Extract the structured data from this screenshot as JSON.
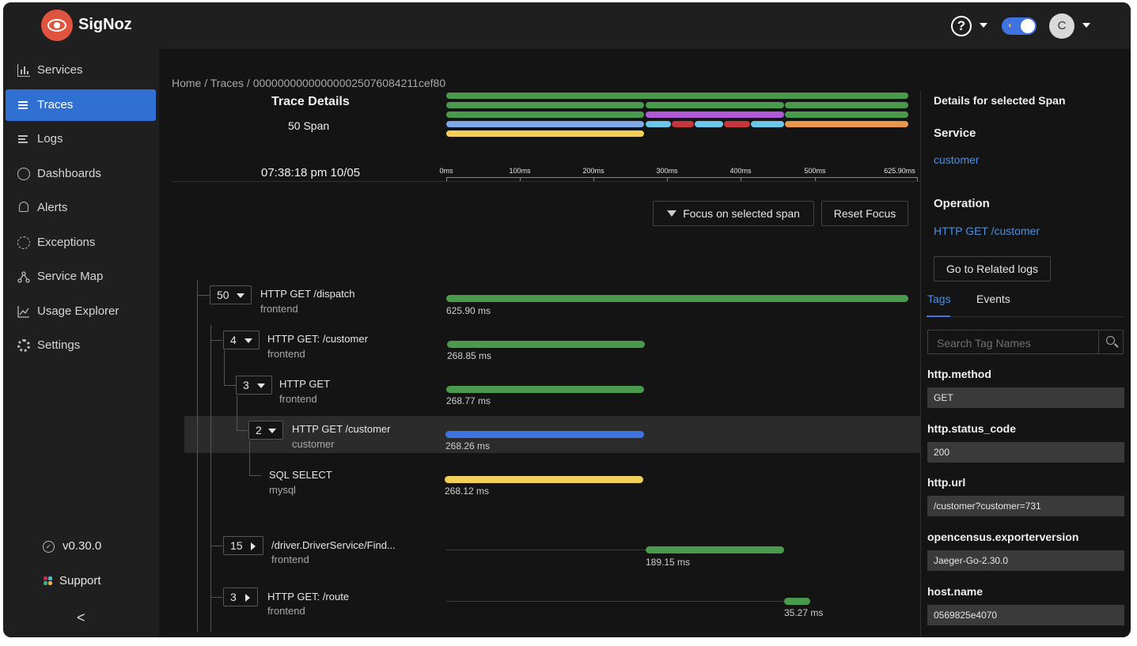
{
  "app": {
    "brand": "SigNoz",
    "help_symbol": "?",
    "avatar_initial": "C",
    "toggle_symbol": "◖"
  },
  "sidebar": {
    "items": [
      {
        "label": "Services",
        "icon": "bar-chart-icon"
      },
      {
        "label": "Traces",
        "icon": "list-icon",
        "active": true
      },
      {
        "label": "Logs",
        "icon": "logs-icon"
      },
      {
        "label": "Dashboards",
        "icon": "dashboard-icon"
      },
      {
        "label": "Alerts",
        "icon": "alarm-icon"
      },
      {
        "label": "Exceptions",
        "icon": "bug-icon"
      },
      {
        "label": "Service Map",
        "icon": "deployment-icon"
      },
      {
        "label": "Usage Explorer",
        "icon": "line-chart-icon"
      },
      {
        "label": "Settings",
        "icon": "settings-icon"
      }
    ],
    "version": "v0.30.0",
    "support": "Support",
    "collapse_symbol": "<",
    "check_symbol": "✓"
  },
  "breadcrumb": "Home  /  Traces  /  000000000000000025076084211cef80",
  "trace": {
    "title": "Trace Details",
    "span_count": "50 Span",
    "time": "07:38:18 pm 10/05",
    "ticks": [
      "0ms",
      "100ms",
      "200ms",
      "300ms",
      "400ms",
      "500ms",
      "625.90ms"
    ]
  },
  "buttons": {
    "focus": "Focus on selected span",
    "reset": "Reset Focus"
  },
  "spans": [
    {
      "count": "50",
      "name": "HTTP GET /dispatch",
      "service": "frontend",
      "duration": "625.90 ms",
      "color": "#4a9a4d"
    },
    {
      "count": "4",
      "name": "HTTP GET: /customer",
      "service": "frontend",
      "duration": "268.85 ms",
      "color": "#4a9a4d"
    },
    {
      "count": "3",
      "name": "HTTP GET",
      "service": "frontend",
      "duration": "268.77 ms",
      "color": "#4a9a4d"
    },
    {
      "count": "2",
      "name": "HTTP GET /customer",
      "service": "customer",
      "duration": "268.26 ms",
      "color": "#3f73e0"
    },
    {
      "count": "",
      "name": "SQL SELECT",
      "service": "mysql",
      "duration": "268.12 ms",
      "color": "#f2cf58"
    },
    {
      "count": "15",
      "name": "/driver.DriverService/Find...",
      "service": "frontend",
      "duration": "189.15 ms",
      "color": "#4a9a4d"
    },
    {
      "count": "3",
      "name": "HTTP GET: /route",
      "service": "frontend",
      "duration": "35.27 ms",
      "color": "#4a9a4d"
    }
  ],
  "details": {
    "title": "Details for selected Span",
    "service_label": "Service",
    "service_value": "customer",
    "operation_label": "Operation",
    "operation_value": "HTTP GET /customer",
    "related_logs": "Go to Related logs",
    "tabs": [
      "Tags",
      "Events"
    ],
    "search_placeholder": "Search Tag Names",
    "tags": [
      {
        "key": "http.method",
        "value": "GET"
      },
      {
        "key": "http.status_code",
        "value": "200"
      },
      {
        "key": "http.url",
        "value": "/customer?customer=731"
      },
      {
        "key": "opencensus.exporterversion",
        "value": "Jaeger-Go-2.30.0"
      },
      {
        "key": "host.name",
        "value": "0569825e4070"
      }
    ]
  },
  "colors": {
    "accent": "#3f73e0",
    "green": "#4a9a4d",
    "yellow": "#f2cf58",
    "purple": "#b05ad8",
    "red": "#c4363a",
    "cyan": "#6cc6ea",
    "orange": "#e9954b",
    "light_blue": "#7ea8e8"
  }
}
